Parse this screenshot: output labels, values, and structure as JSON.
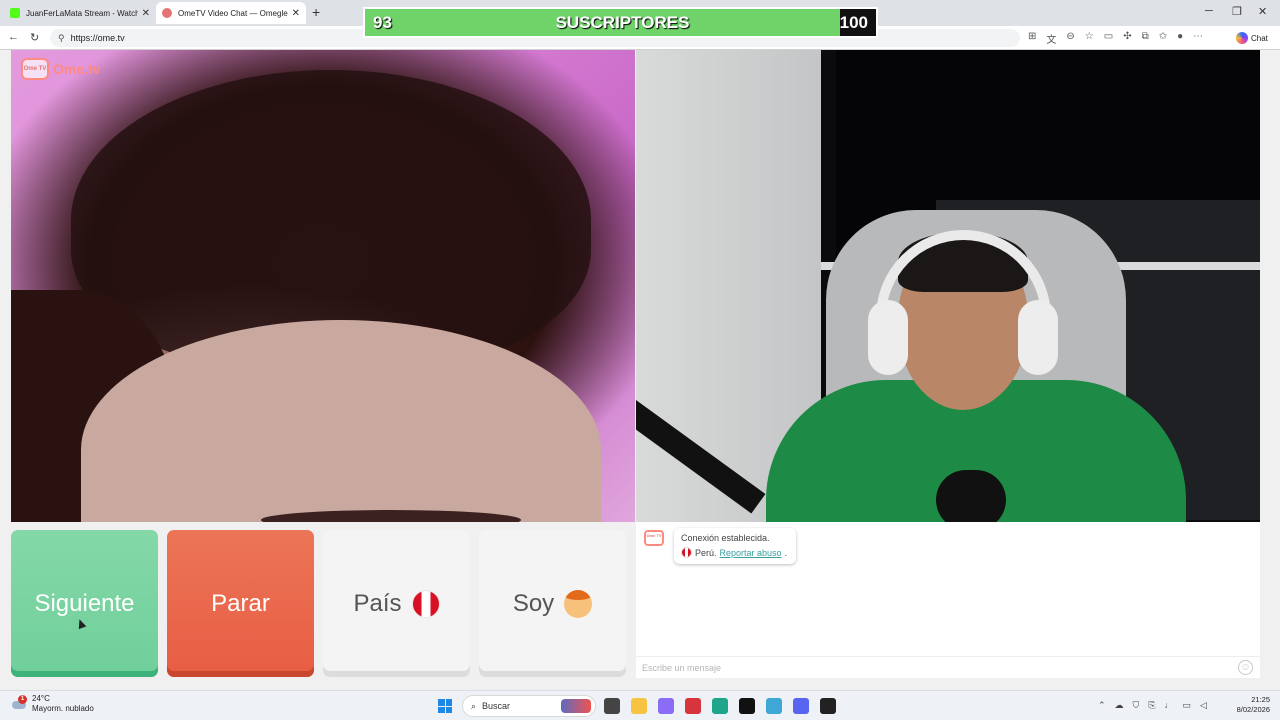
{
  "browser": {
    "tabs": [
      {
        "title": "JuanFerLaMata Stream - Watch Li...",
        "favicon_color": "#53fc18",
        "active": false
      },
      {
        "title": "OmeTV Video Chat — Omegle...",
        "favicon_color": "#e57373",
        "active": true
      }
    ],
    "new_tab_icon": "+",
    "url": "https://ome.tv",
    "copilot_label": "Chat"
  },
  "overlay": {
    "current": "93",
    "label": "SUSCRIPTORES",
    "goal": "100",
    "progress_fraction": 0.93,
    "bar_color": "#6fd36a"
  },
  "site": {
    "logo_text": "Ome.tv",
    "logo_badge": "Ome TV"
  },
  "controls": {
    "next_label": "Siguiente",
    "stop_label": "Parar",
    "country_label": "País",
    "gender_label": "Soy",
    "country_flag": "peru-flag-icon",
    "gender_icon": "boy-emoji-icon",
    "next_color": "#6fcf9a",
    "stop_color": "#e85d44"
  },
  "chat": {
    "status": "Conexión establecida.",
    "country": "Perú.",
    "report_link": "Reportar abuso",
    "trailing": ".",
    "input_placeholder": "Escribe un mensaje"
  },
  "taskbar": {
    "badge_count": "1",
    "temperature": "24°C",
    "condition": "Mayorm. nublado",
    "search_label": "Buscar",
    "time": "21:25",
    "date": "8/02/2026"
  }
}
